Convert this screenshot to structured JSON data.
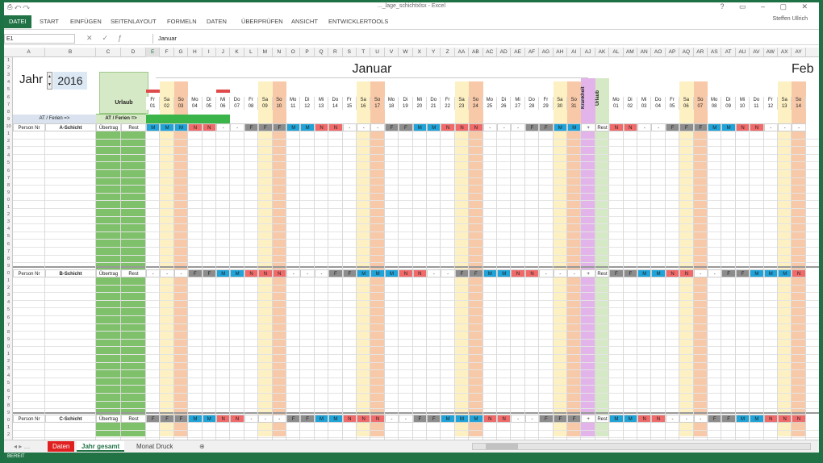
{
  "window": {
    "title": "..._lage_schichtxlsx - Excel",
    "user": "Steffen Ullrich"
  },
  "ribbon": {
    "tabs": [
      "DATEI",
      "START",
      "EINFÜGEN",
      "SEITENLAYOUT",
      "FORMELN",
      "DATEN",
      "ÜBERPRÜFEN",
      "ANSICHT",
      "ENTWICKLERTOOLS"
    ]
  },
  "formula_bar": {
    "name_box": "E1",
    "content": "Januar"
  },
  "columns": [
    "A",
    "B",
    "C",
    "D",
    "E",
    "F",
    "G",
    "H",
    "I",
    "J",
    "K",
    "L",
    "M",
    "N",
    "O",
    "P",
    "Q",
    "R",
    "S",
    "T",
    "U",
    "V",
    "W",
    "X",
    "Y",
    "Z",
    "AA",
    "AB",
    "AC",
    "AD",
    "AE",
    "AF",
    "AG",
    "AH",
    "AI",
    "AJ",
    "AK",
    "AL",
    "AM",
    "AN",
    "AO",
    "AP",
    "AQ",
    "AR",
    "AS",
    "AT",
    "AU",
    "AV",
    "AW",
    "AX",
    "AY"
  ],
  "rows": [
    "1",
    "2",
    "3",
    "4",
    "5",
    "6",
    "7",
    "8",
    "9",
    "10",
    "1",
    "2",
    "3",
    "4",
    "5",
    "6",
    "7",
    "8",
    "9",
    "0",
    "1",
    "2",
    "3",
    "4",
    "5",
    "6",
    "7",
    "8",
    "9",
    "0",
    "1",
    "2",
    "3",
    "4",
    "5",
    "6",
    "7",
    "8",
    "9",
    "0",
    "1",
    "2",
    "3",
    "4",
    "5",
    "6",
    "7",
    "8",
    "9",
    "0",
    "1",
    "2"
  ],
  "sheet": {
    "year_label": "Jahr",
    "year_value": "2016",
    "urlaub": "Urlaub",
    "month1": "Januar",
    "month2": "Feb",
    "at_ferien": "AT / Ferien =>",
    "krankheit": "Krankheit",
    "urlaub_col": "Urlaub",
    "headers": {
      "personal": "Person Nr",
      "uebertrag": "Übertrag",
      "rest": "Rest",
      "plus": "+"
    },
    "shifts": [
      "A-Schicht",
      "B-Schicht",
      "C-Schicht"
    ],
    "jan_days": [
      {
        "wd": "Fr",
        "d": "01"
      },
      {
        "wd": "Sa",
        "d": "02"
      },
      {
        "wd": "So",
        "d": "03"
      },
      {
        "wd": "Mo",
        "d": "04"
      },
      {
        "wd": "Di",
        "d": "05"
      },
      {
        "wd": "Mi",
        "d": "06"
      },
      {
        "wd": "Do",
        "d": "07"
      },
      {
        "wd": "Fr",
        "d": "08"
      },
      {
        "wd": "Sa",
        "d": "09"
      },
      {
        "wd": "So",
        "d": "10"
      },
      {
        "wd": "Mo",
        "d": "11"
      },
      {
        "wd": "Di",
        "d": "12"
      },
      {
        "wd": "Mi",
        "d": "13"
      },
      {
        "wd": "Do",
        "d": "14"
      },
      {
        "wd": "Fr",
        "d": "15"
      },
      {
        "wd": "Sa",
        "d": "16"
      },
      {
        "wd": "So",
        "d": "17"
      },
      {
        "wd": "Mo",
        "d": "18"
      },
      {
        "wd": "Di",
        "d": "19"
      },
      {
        "wd": "Mi",
        "d": "20"
      },
      {
        "wd": "Do",
        "d": "21"
      },
      {
        "wd": "Fr",
        "d": "22"
      },
      {
        "wd": "Sa",
        "d": "23"
      },
      {
        "wd": "So",
        "d": "24"
      },
      {
        "wd": "Mo",
        "d": "25"
      },
      {
        "wd": "Di",
        "d": "26"
      },
      {
        "wd": "Mi",
        "d": "27"
      },
      {
        "wd": "Do",
        "d": "28"
      },
      {
        "wd": "Fr",
        "d": "29"
      },
      {
        "wd": "Sa",
        "d": "30"
      },
      {
        "wd": "So",
        "d": "31"
      }
    ],
    "feb_days": [
      {
        "wd": "Mo",
        "d": "01"
      },
      {
        "wd": "Di",
        "d": "02"
      },
      {
        "wd": "Mi",
        "d": "03"
      },
      {
        "wd": "Do",
        "d": "04"
      },
      {
        "wd": "Fr",
        "d": "05"
      },
      {
        "wd": "Sa",
        "d": "06"
      },
      {
        "wd": "So",
        "d": "07"
      },
      {
        "wd": "Mo",
        "d": "08"
      },
      {
        "wd": "Di",
        "d": "09"
      },
      {
        "wd": "Mi",
        "d": "10"
      },
      {
        "wd": "Do",
        "d": "11"
      },
      {
        "wd": "Fr",
        "d": "12"
      },
      {
        "wd": "Sa",
        "d": "13"
      },
      {
        "wd": "So",
        "d": "14"
      }
    ],
    "pattern_a_jan": [
      "M",
      "M",
      "M",
      "N",
      "N",
      "-",
      "-",
      "F",
      "F",
      "F",
      "M",
      "M",
      "N",
      "N",
      "-",
      "-",
      "-",
      "F",
      "F",
      "M",
      "M",
      "N",
      "N",
      "N",
      "-",
      "-",
      "-",
      "F",
      "F",
      "M",
      "M"
    ],
    "pattern_a_feb": [
      "N",
      "N",
      "-",
      "-",
      "F",
      "F",
      "F",
      "M",
      "M",
      "N",
      "N",
      "-",
      "-",
      "-"
    ],
    "pattern_b_jan": [
      "-",
      "-",
      "-",
      "F",
      "F",
      "M",
      "M",
      "N",
      "N",
      "N",
      "-",
      "-",
      "-",
      "F",
      "F",
      "M",
      "M",
      "M",
      "N",
      "N",
      "-",
      "-",
      "F",
      "F",
      "M",
      "M",
      "N",
      "N",
      "-",
      "-",
      "-"
    ],
    "pattern_b_feb": [
      "F",
      "F",
      "M",
      "M",
      "N",
      "N",
      "-",
      "-",
      "F",
      "F",
      "M",
      "M",
      "M",
      "N"
    ],
    "pattern_c_jan": [
      "F",
      "F",
      "F",
      "M",
      "M",
      "N",
      "N",
      "-",
      "-",
      "-",
      "F",
      "F",
      "M",
      "M",
      "N",
      "N",
      "N",
      "-",
      "-",
      "F",
      "F",
      "M",
      "M",
      "M",
      "N",
      "N",
      "-",
      "-",
      "F",
      "F",
      "F"
    ],
    "pattern_c_feb": [
      "M",
      "M",
      "N",
      "N",
      "-",
      "-",
      "-",
      "F",
      "F",
      "M",
      "M",
      "N",
      "N",
      "N"
    ]
  },
  "sheet_tabs": [
    "Daten",
    "Jahr gesamt",
    "Monat Druck"
  ],
  "status": "BEREIT",
  "colors": {
    "M": "#1fa3d8",
    "N": "#f06a6a",
    "F": "#8c8c8c",
    "-": "#ffffff",
    "sa": "#fdf1c4",
    "so": "#f7c9a8",
    "urlaub": "#7fc16a",
    "krank": "#e3b4ea",
    "excel": "#217346"
  }
}
